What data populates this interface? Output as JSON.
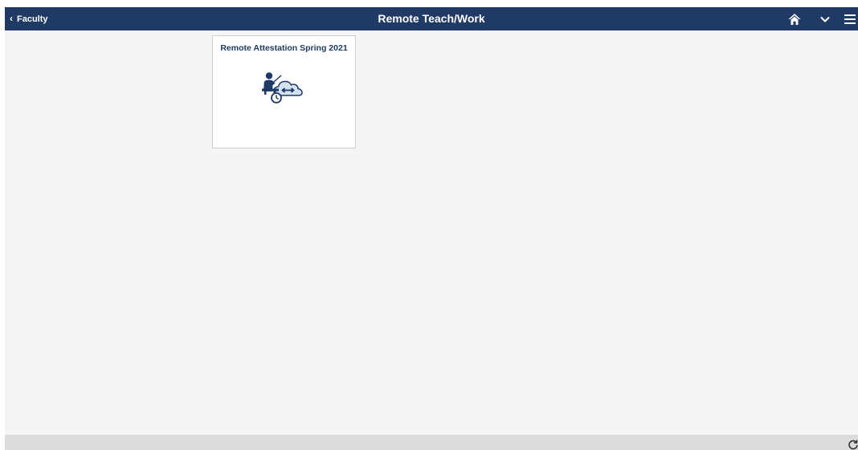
{
  "header": {
    "back_label": "Faculty",
    "title": "Remote Teach/Work",
    "icons": [
      "home-icon",
      "chevron-down-icon",
      "hamburger-menu-icon"
    ]
  },
  "tiles": [
    {
      "label": "Remote Attestation Spring 2021",
      "icon": "teacher-cloud-icon"
    }
  ],
  "footer": {
    "icon": "refresh-icon"
  },
  "colors": {
    "header_bg": "#1f3a64",
    "page_bg": "#f5f5f5",
    "tile_title": "#1f3a64",
    "icon_light": "#a9c3e3"
  }
}
